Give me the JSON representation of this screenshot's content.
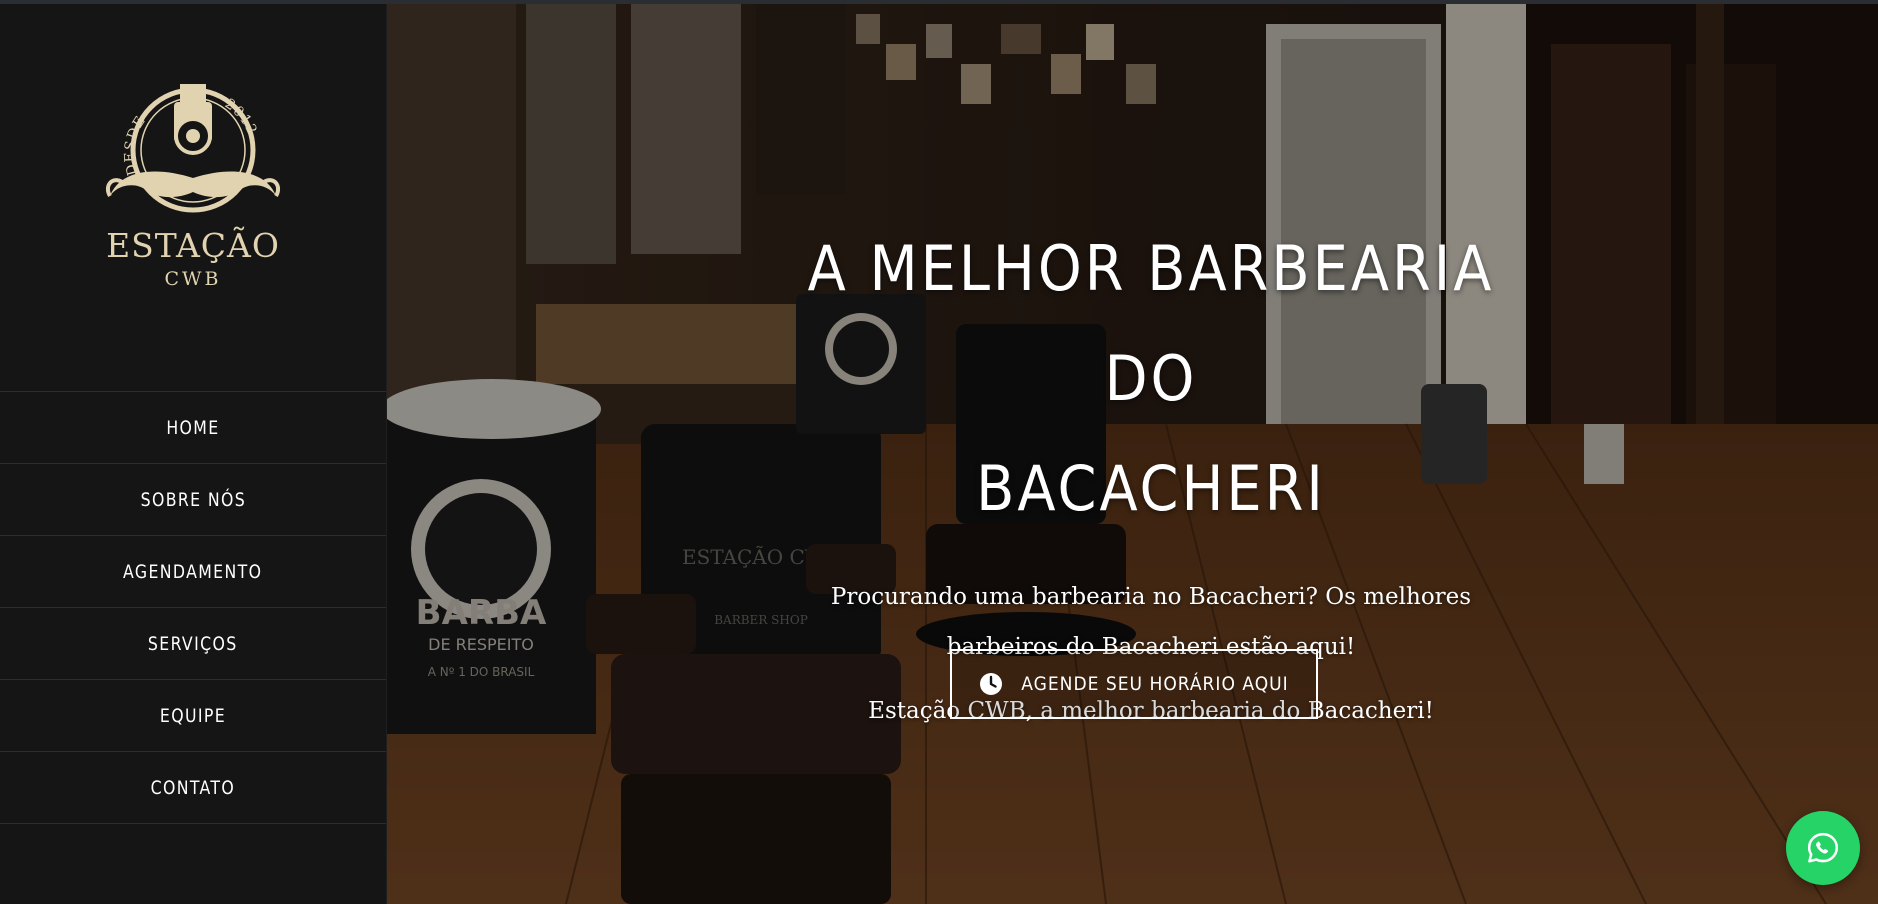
{
  "brand": {
    "name": "ESTAÇÃO",
    "city": "CWB",
    "emblem_left": "DESDE",
    "emblem_right": "2012",
    "color": "#e2d3b0"
  },
  "nav": {
    "items": [
      {
        "label": "HOME"
      },
      {
        "label": "SOBRE NÓS"
      },
      {
        "label": "AGENDAMENTO"
      },
      {
        "label": "SERVIÇOS"
      },
      {
        "label": "EQUIPE"
      },
      {
        "label": "CONTATO"
      }
    ]
  },
  "hero": {
    "title_line1": "A MELHOR BARBEARIA DO",
    "title_line2": "BACACHERI",
    "paragraph1": "Procurando uma barbearia no Bacacheri? Os melhores barbeiros do Bacacheri estão aqui!",
    "paragraph2": "Estação CWB, a melhor barbearia do Bacacheri!",
    "cta_label": "AGENDE SEU HORÁRIO AQUI",
    "cta_icon": "clock-icon"
  },
  "whatsapp": {
    "icon": "whatsapp-icon",
    "color": "#25d366"
  },
  "background_signs": {
    "shirt_brand": "BARBA",
    "shirt_tagline": "DE RESPEITO",
    "shirt_slogan": "A Nº 1 DO BRASIL",
    "chair_text": "ESTAÇÃO CWB",
    "chair_sub": "BARBER SHOP"
  }
}
